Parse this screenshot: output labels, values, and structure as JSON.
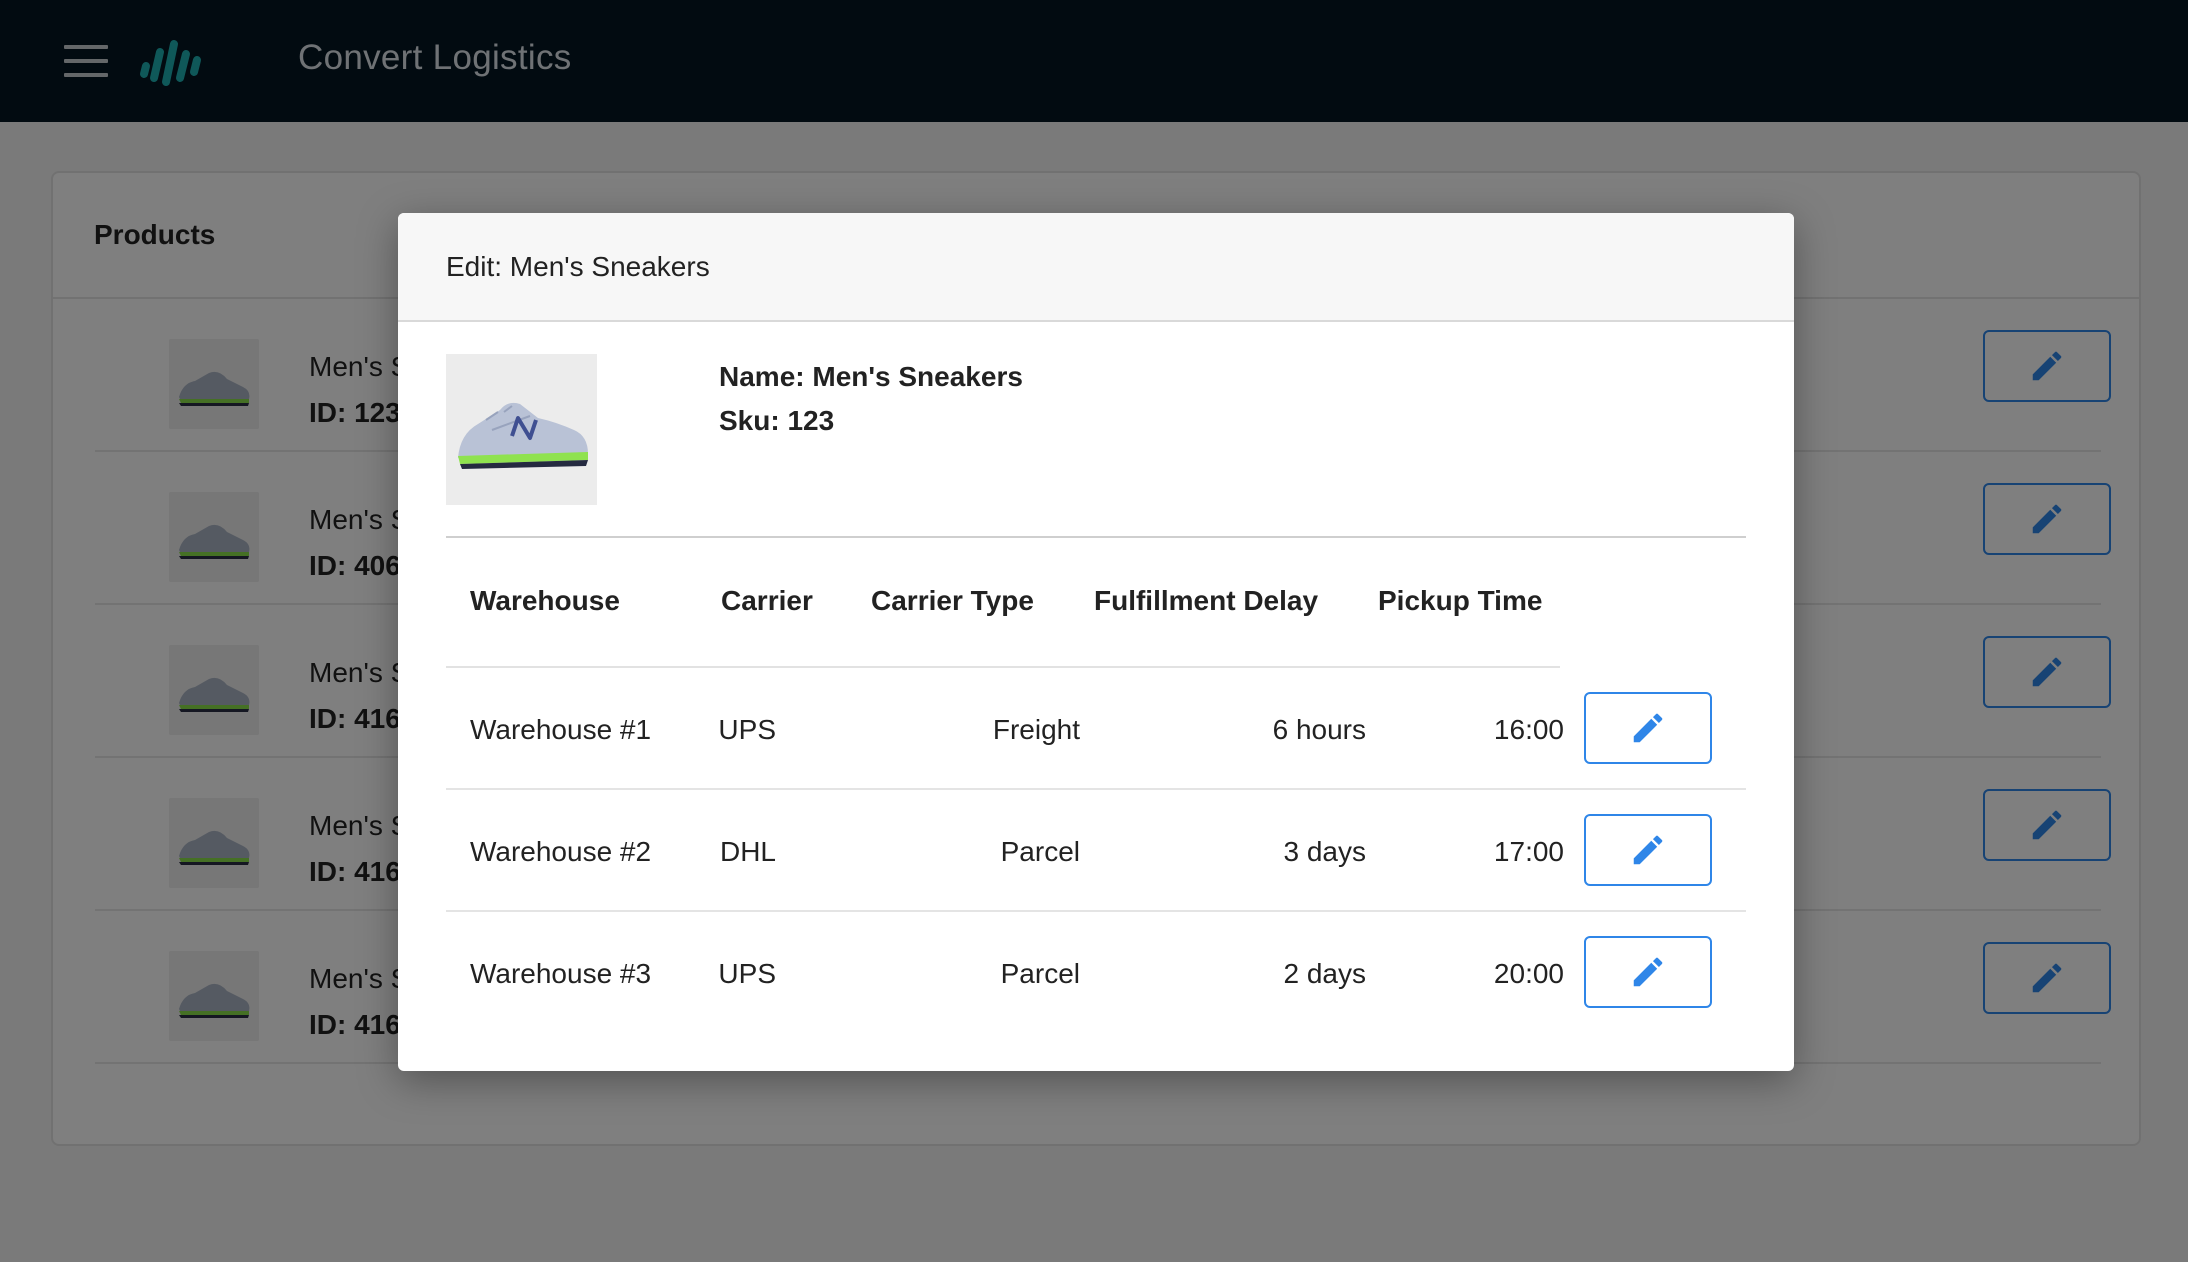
{
  "appbar": {
    "menu_icon": "hamburger-menu-icon",
    "logo_icon": "wave-bars-logo-icon",
    "title": "Convert Logistics",
    "background": "#041723",
    "logo_color": "#1fb0b3"
  },
  "products_card": {
    "title": "Products",
    "rows": [
      {
        "name": "Men's S",
        "id": "ID: 123"
      },
      {
        "name": "Men's S",
        "id": "ID: 406"
      },
      {
        "name": "Men's S",
        "id": "ID: 416"
      },
      {
        "name": "Men's S",
        "id": "ID: 416"
      },
      {
        "name": "Men's S",
        "id": "ID: 416"
      }
    ],
    "edit_icon": "pencil-icon"
  },
  "modal": {
    "title": "Edit: Men's Sneakers",
    "product_image": "sneaker-image",
    "name_line": "Name: Men's Sneakers",
    "sku_line": "Sku: 123",
    "columns": [
      "Warehouse",
      "Carrier",
      "Carrier Type",
      "Fulfillment Delay",
      "Pickup Time"
    ],
    "rows": [
      {
        "warehouse": "Warehouse #1",
        "carrier": "UPS",
        "carrier_type": "Freight",
        "delay": "6 hours",
        "pickup": "16:00"
      },
      {
        "warehouse": "Warehouse #2",
        "carrier": "DHL",
        "carrier_type": "Parcel",
        "delay": "3 days",
        "pickup": "17:00"
      },
      {
        "warehouse": "Warehouse #3",
        "carrier": "UPS",
        "carrier_type": "Parcel",
        "delay": "2 days",
        "pickup": "20:00"
      }
    ],
    "edit_icon": "pencil-icon",
    "accent": "#2f86e8"
  }
}
